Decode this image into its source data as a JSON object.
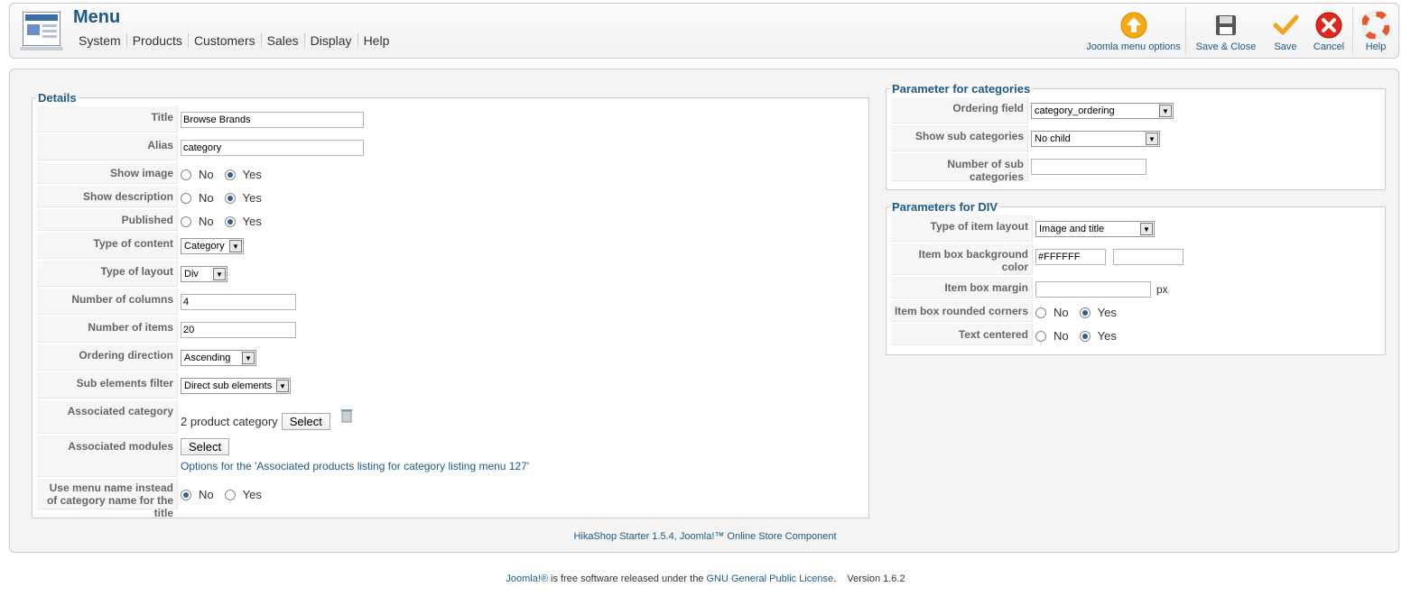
{
  "header": {
    "title": "Menu",
    "menu": [
      "System",
      "Products",
      "Customers",
      "Sales",
      "Display",
      "Help"
    ],
    "toolbar": {
      "options": "Joomla menu options",
      "save_close": "Save & Close",
      "save": "Save",
      "cancel": "Cancel",
      "help": "Help"
    }
  },
  "details": {
    "legend": "Details",
    "title_label": "Title",
    "title_value": "Browse Brands",
    "alias_label": "Alias",
    "alias_value": "category",
    "show_image_label": "Show image",
    "show_description_label": "Show description",
    "published_label": "Published",
    "no": "No",
    "yes": "Yes",
    "type_content_label": "Type of content",
    "type_content_value": "Category",
    "type_layout_label": "Type of layout",
    "type_layout_value": "Div",
    "num_columns_label": "Number of columns",
    "num_columns_value": "4",
    "num_items_label": "Number of items",
    "num_items_value": "20",
    "ordering_dir_label": "Ordering direction",
    "ordering_dir_value": "Ascending",
    "sub_filter_label": "Sub elements filter",
    "sub_filter_value": "Direct sub elements",
    "assoc_category_label": "Associated category",
    "assoc_category_value": "2 product category",
    "select": "Select",
    "assoc_modules_label": "Associated modules",
    "options_link": "Options for the 'Associated products listing for category listing menu 127'",
    "use_menu_name_label": "Use menu name instead of category name for the title"
  },
  "cat_params": {
    "legend": "Parameter for categories",
    "ordering_field_label": "Ordering field",
    "ordering_field_value": "category_ordering",
    "show_sub_label": "Show sub categories",
    "show_sub_value": "No child",
    "num_sub_label": "Number of sub categories",
    "num_sub_value": ""
  },
  "div_params": {
    "legend": "Parameters for DIV",
    "layout_label": "Type of item layout",
    "layout_value": "Image and title",
    "bg_label": "Item box background color",
    "bg_value": "#FFFFFF",
    "margin_label": "Item box margin",
    "margin_unit": "px",
    "rounded_label": "Item box rounded corners",
    "centered_label": "Text centered",
    "no": "No",
    "yes": "Yes"
  },
  "footer": {
    "component": "HikaShop Starter 1.5.4, Joomla!™ Online Store Component",
    "joomla": "Joomla!®",
    "text1": " is free software released under the ",
    "license": "GNU General Public License",
    "version": ".    Version 1.6.2"
  },
  "colors": {
    "accent": "#1c5a8b",
    "panel": "#f4f4f4",
    "border": "#cccccc"
  }
}
